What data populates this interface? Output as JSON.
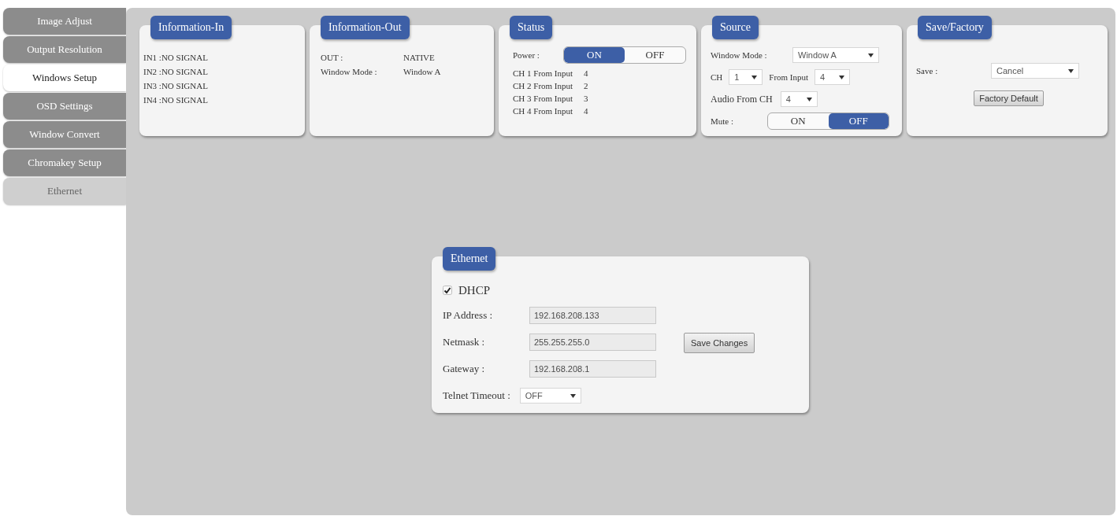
{
  "sidebar": {
    "items": [
      {
        "label": "Image Adjust",
        "selected": false,
        "disabled": false
      },
      {
        "label": "Output Resolution",
        "selected": false,
        "disabled": false
      },
      {
        "label": "Windows Setup",
        "selected": true,
        "disabled": false
      },
      {
        "label": "OSD Settings",
        "selected": false,
        "disabled": false
      },
      {
        "label": "Window Convert",
        "selected": false,
        "disabled": false
      },
      {
        "label": "Chromakey Setup",
        "selected": false,
        "disabled": false
      },
      {
        "label": "Ethernet",
        "selected": false,
        "disabled": true
      }
    ]
  },
  "information_in": {
    "title": "Information-In",
    "lines": [
      "IN1 :NO SIGNAL",
      "IN2 :NO SIGNAL",
      "IN3 :NO SIGNAL",
      "IN4 :NO SIGNAL"
    ]
  },
  "information_out": {
    "title": "Information-Out",
    "rows": [
      {
        "label": "OUT :",
        "value": "NATIVE"
      },
      {
        "label": "Window Mode :",
        "value": "Window A"
      }
    ]
  },
  "status": {
    "title": "Status",
    "power": {
      "label": "Power :",
      "options": [
        {
          "label": "ON",
          "selected": true
        },
        {
          "label": "OFF",
          "selected": false
        }
      ]
    },
    "channels": [
      {
        "label": "CH 1 From Input",
        "value": "4"
      },
      {
        "label": "CH 2 From Input",
        "value": "2"
      },
      {
        "label": "CH 3 From Input",
        "value": "3"
      },
      {
        "label": "CH 4 From Input",
        "value": "4"
      }
    ]
  },
  "source": {
    "title": "Source",
    "window_mode": {
      "label": "Window Mode :",
      "value": "Window A"
    },
    "channel": {
      "label": "CH",
      "value": "1"
    },
    "from_input": {
      "label": "From Input",
      "value": "4"
    },
    "audio_from_ch": {
      "label": "Audio From CH",
      "value": "4"
    },
    "mute": {
      "label": "Mute :",
      "options": [
        {
          "label": "ON",
          "selected": false
        },
        {
          "label": "OFF",
          "selected": true
        }
      ]
    }
  },
  "save_factory": {
    "title": "Save/Factory",
    "save": {
      "label": "Save :",
      "value": "Cancel"
    },
    "button": "Factory Default"
  },
  "ethernet": {
    "title": "Ethernet",
    "dhcp": {
      "label": "DHCP",
      "checked": true
    },
    "fields": [
      {
        "label": "IP Address :",
        "value": "192.168.208.133",
        "disabled": true
      },
      {
        "label": "Netmask :",
        "value": "255.255.255.0",
        "disabled": true
      },
      {
        "label": "Gateway :",
        "value": "192.168.208.1",
        "disabled": true
      }
    ],
    "telnet_timeout": {
      "label": "Telnet Timeout :",
      "value": "OFF"
    },
    "button": "Save Changes"
  }
}
